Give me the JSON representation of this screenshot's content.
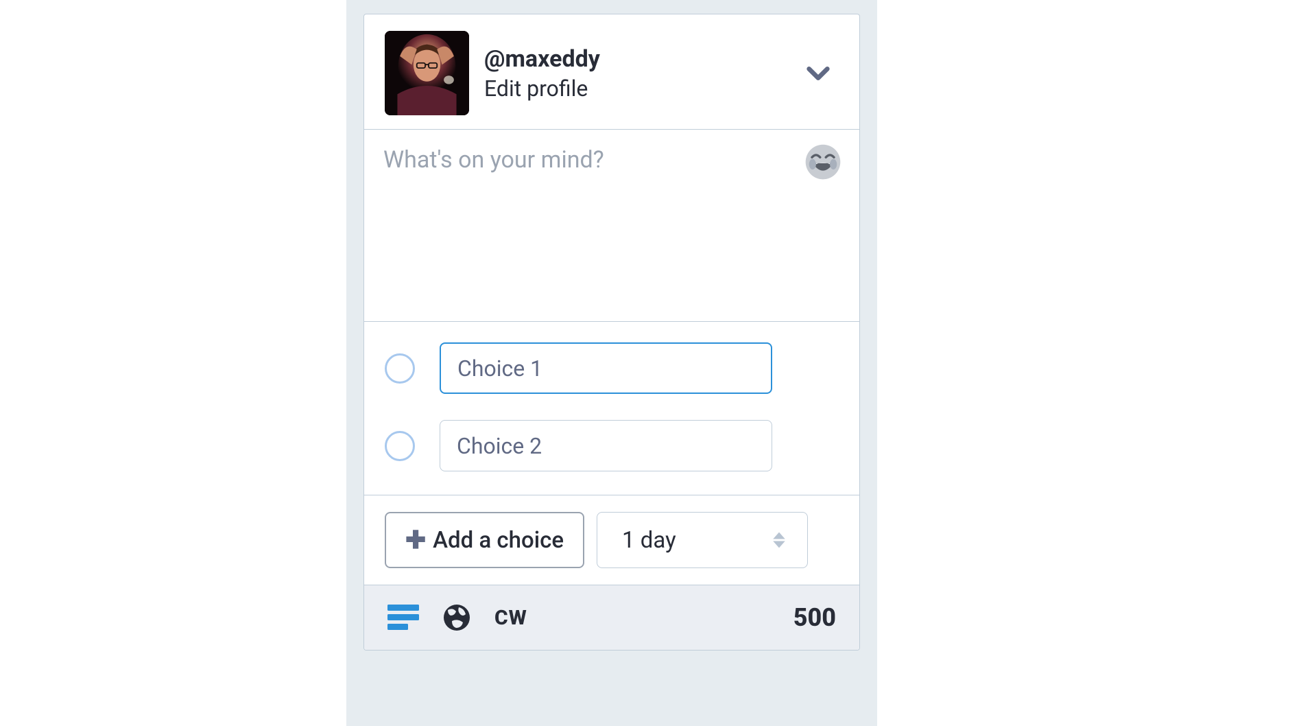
{
  "profile": {
    "handle": "@maxeddy",
    "edit_label": "Edit profile"
  },
  "compose": {
    "placeholder": "What's on your mind?"
  },
  "poll": {
    "choices": [
      {
        "placeholder": "Choice 1",
        "focused": true
      },
      {
        "placeholder": "Choice 2",
        "focused": false
      }
    ],
    "add_choice_label": "Add a choice",
    "duration_label": "1 day"
  },
  "toolbar": {
    "cw_label": "CW",
    "char_count": "500"
  }
}
